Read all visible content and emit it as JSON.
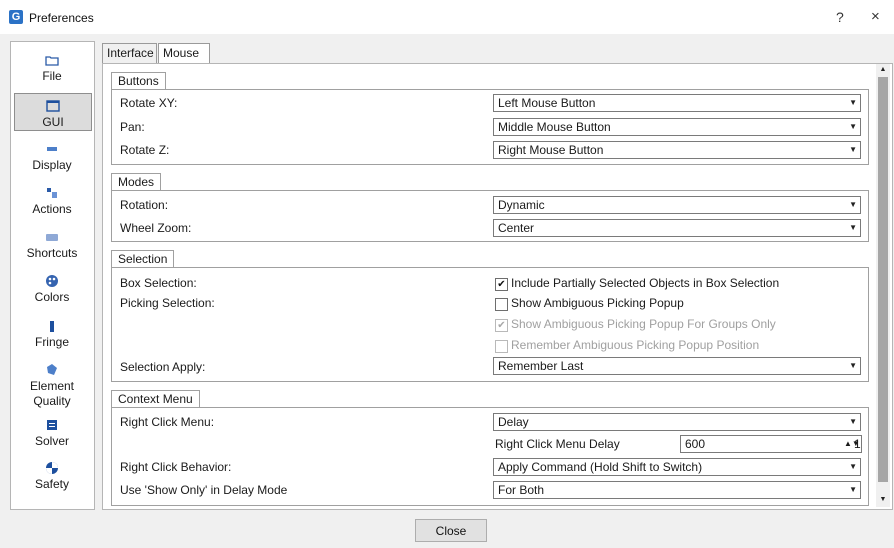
{
  "window": {
    "title": "Preferences",
    "help": "?",
    "close": "×",
    "app_icon": "G"
  },
  "sidebar": {
    "items": [
      {
        "label": "File",
        "icon": "folder-icon"
      },
      {
        "label": "GUI",
        "icon": "window-icon",
        "selected": true
      },
      {
        "label": "Display",
        "icon": "display-icon"
      },
      {
        "label": "Actions",
        "icon": "actions-icon"
      },
      {
        "label": "Shortcuts",
        "icon": "keyboard-icon"
      },
      {
        "label": "Colors",
        "icon": "palette-icon"
      },
      {
        "label": "Fringe",
        "icon": "fringe-icon"
      },
      {
        "label": "Element Quality",
        "icon": "element-quality-icon"
      },
      {
        "label": "Solver",
        "icon": "solver-icon"
      },
      {
        "label": "Safety",
        "icon": "safety-icon"
      }
    ]
  },
  "tabs": [
    "Interface",
    "Mouse"
  ],
  "active_tab": "Mouse",
  "groups": {
    "buttons": {
      "title": "Buttons",
      "rows": [
        {
          "label": "Rotate XY:",
          "value": "Left Mouse Button"
        },
        {
          "label": "Pan:",
          "value": "Middle Mouse Button"
        },
        {
          "label": "Rotate Z:",
          "value": "Right Mouse Button"
        }
      ]
    },
    "modes": {
      "title": "Modes",
      "rows": [
        {
          "label": "Rotation:",
          "value": "Dynamic"
        },
        {
          "label": "Wheel Zoom:",
          "value": "Center"
        }
      ]
    },
    "selection": {
      "title": "Selection",
      "box_label": "Box Selection:",
      "picking_label": "Picking Selection:",
      "checks": [
        {
          "label": "Include Partially Selected Objects in Box Selection",
          "checked": true,
          "enabled": true
        },
        {
          "label": "Show Ambiguous Picking Popup",
          "checked": false,
          "enabled": true
        },
        {
          "label": "Show Ambiguous Picking Popup For Groups Only",
          "checked": true,
          "enabled": false
        },
        {
          "label": "Remember Ambiguous Picking Popup Position",
          "checked": false,
          "enabled": false
        }
      ],
      "apply_label": "Selection Apply:",
      "apply_value": "Remember Last"
    },
    "context_menu": {
      "title": "Context Menu",
      "right_click_label": "Right Click Menu:",
      "right_click_value": "Delay",
      "delay_label": "Right Click Menu Delay",
      "delay_value": "600",
      "delay_step": "1",
      "behavior_label": "Right Click Behavior:",
      "behavior_value": "Apply Command (Hold Shift to Switch)",
      "show_only_label": "Use 'Show Only' in Delay Mode",
      "show_only_value": "For Both"
    }
  },
  "footer": {
    "close_label": "Close"
  },
  "colors": {
    "accent": "#2b72c6",
    "selected_nav": "#dcdcdc",
    "scroll_thumb": "#a6a6a6"
  }
}
